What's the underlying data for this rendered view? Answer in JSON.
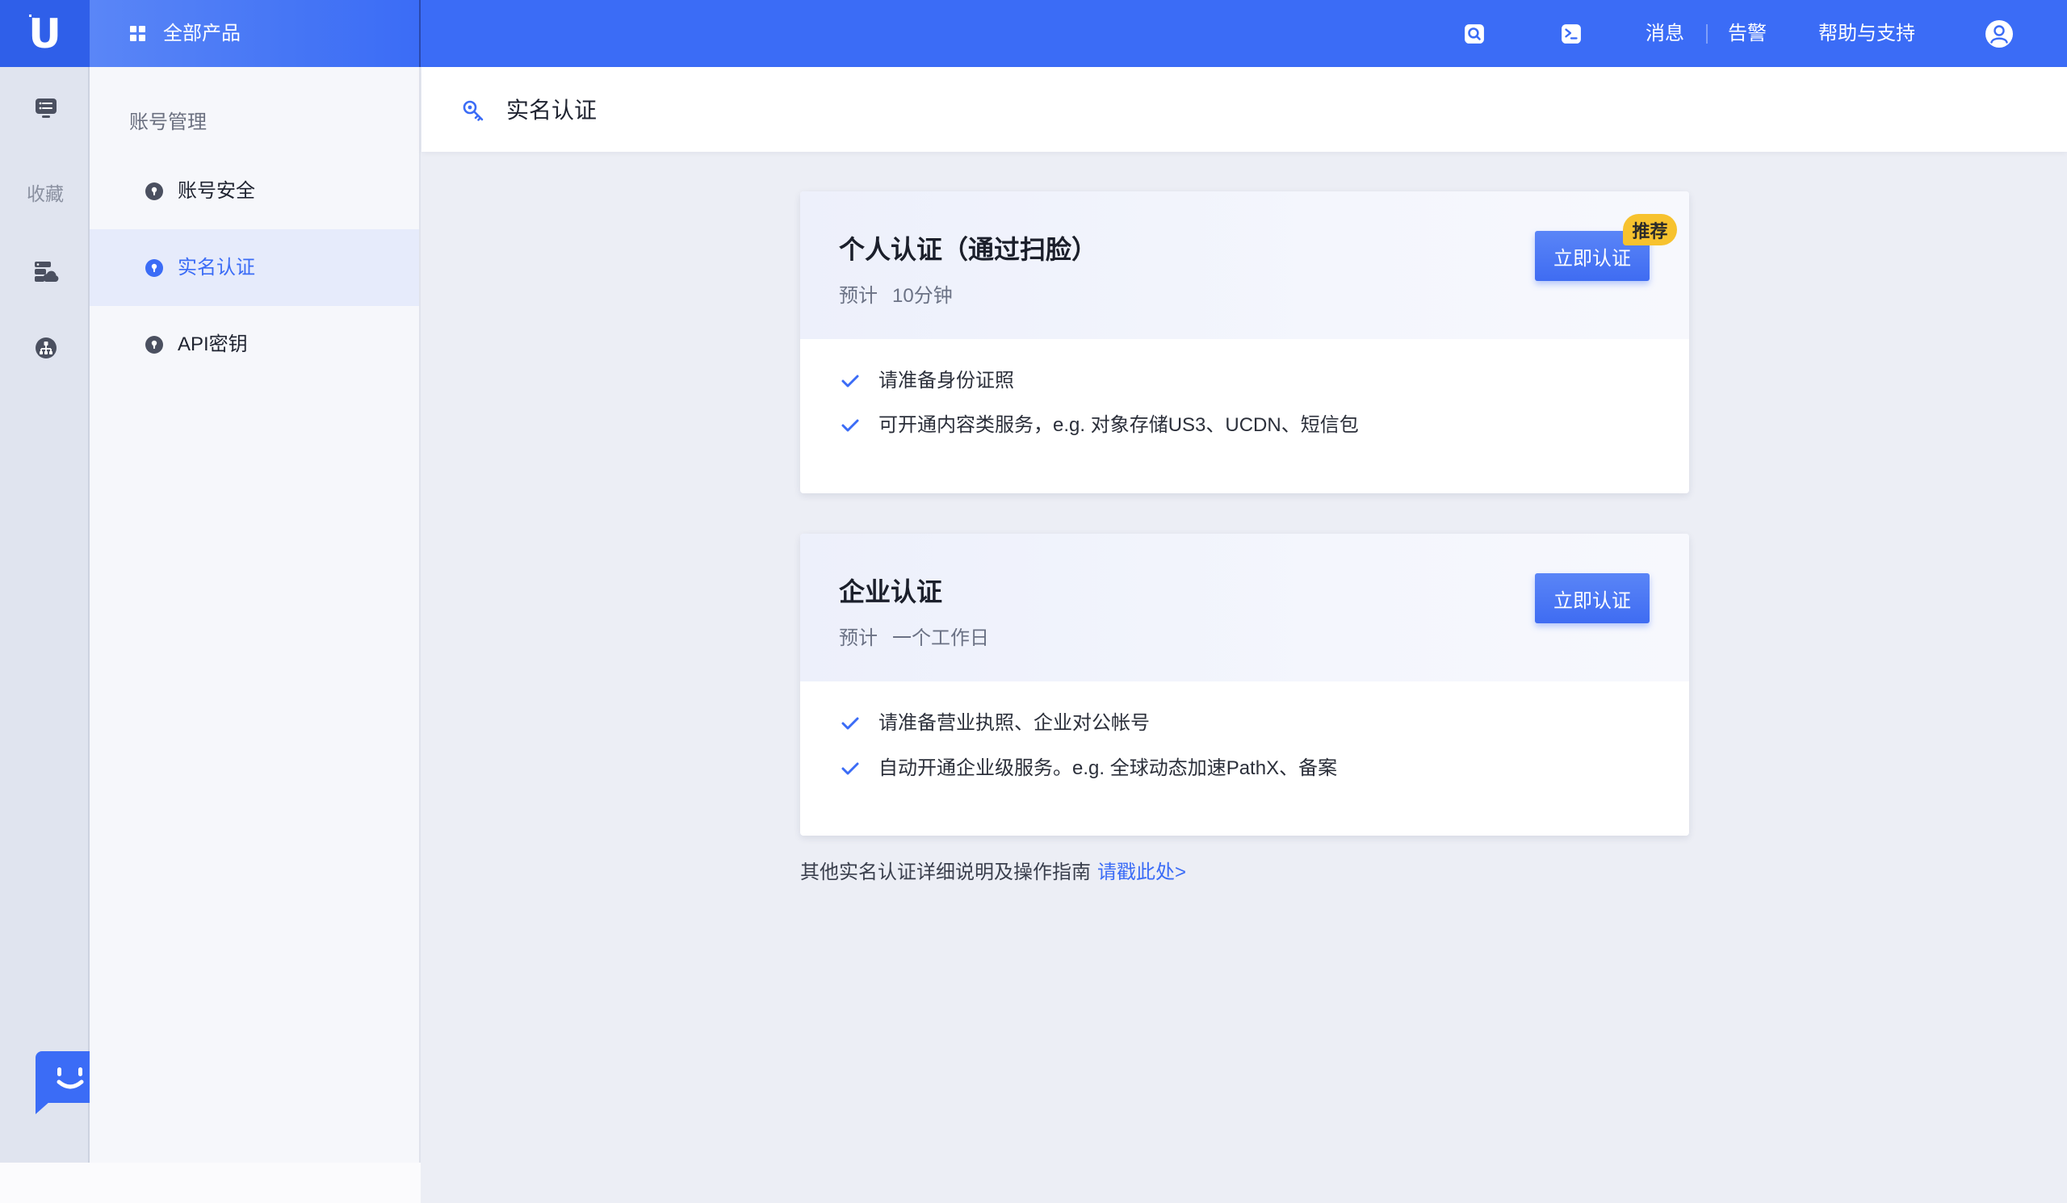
{
  "app": {
    "logo_letter": "U",
    "all_products_label": "全部产品"
  },
  "topbar": {
    "messages_label": "消息",
    "alerts_label": "告警",
    "help_label": "帮助与支持",
    "icons": [
      "search-icon",
      "terminal-icon",
      "user-avatar-icon"
    ]
  },
  "rail": {
    "favorites_label": "收藏",
    "icons": [
      "monitor-list-icon",
      "cloud-server-icon",
      "network-icon",
      "chatbot-icon"
    ]
  },
  "sidebar": {
    "section_title": "账号管理",
    "items": [
      {
        "label": "账号安全",
        "active": false
      },
      {
        "label": "实名认证",
        "active": true
      },
      {
        "label": "API密钥",
        "active": false
      }
    ]
  },
  "page": {
    "title": "实名认证"
  },
  "cards": [
    {
      "title": "个人认证（通过扫脸）",
      "estimate_label": "预计",
      "estimate_value": "10分钟",
      "button_label": "立即认证",
      "badge": "推荐",
      "checklist": [
        "请准备身份证照",
        "可开通内容类服务，e.g. 对象存储US3、UCDN、短信包"
      ]
    },
    {
      "title": "企业认证",
      "estimate_label": "预计",
      "estimate_value": "一个工作日",
      "button_label": "立即认证",
      "checklist": [
        "请准备营业执照、企业对公帐号",
        "自动开通企业级服务。e.g. 全球动态加速PathX、备案"
      ]
    }
  ],
  "footer": {
    "text": "其他实名认证详细说明及操作指南",
    "link_label": "请戳此处>"
  },
  "colors": {
    "brand": "#3b6cf6",
    "brand_dark": "#2f5fe9",
    "badge": "#f7c22e",
    "page_bg": "#eceef5",
    "sidebar_bg": "#f6f7fb",
    "rail_bg": "#e0e4ef",
    "active_bg": "#e6ebfb"
  }
}
